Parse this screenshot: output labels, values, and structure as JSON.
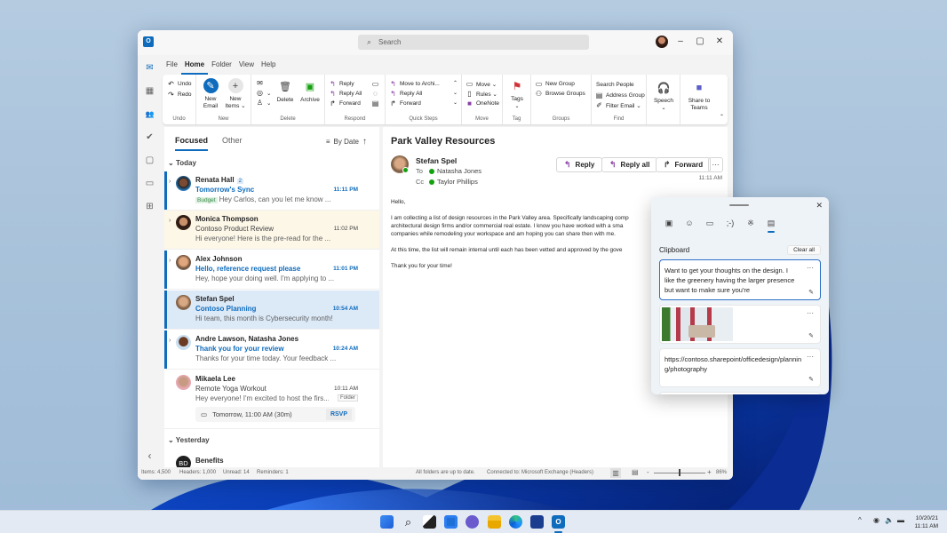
{
  "window": {
    "app_name": "Outlook",
    "search_placeholder": "Search",
    "controls": {
      "minimize": "–",
      "maximize": "▢",
      "close": "✕"
    }
  },
  "left_rail": {
    "items": [
      {
        "name": "mail",
        "icon": "✉"
      },
      {
        "name": "calendar",
        "icon": "▦"
      },
      {
        "name": "people",
        "icon": "👥"
      },
      {
        "name": "tasks",
        "icon": "✔"
      },
      {
        "name": "notes",
        "icon": "▢"
      },
      {
        "name": "folders",
        "icon": "▭"
      },
      {
        "name": "apps",
        "icon": "⊞"
      }
    ],
    "collapse": "‹"
  },
  "menu": {
    "items": [
      "File",
      "Home",
      "Folder",
      "View",
      "Help"
    ],
    "active": "Home"
  },
  "ribbon": {
    "undo": {
      "undo": "Undo",
      "redo": "Redo",
      "label": "Undo"
    },
    "new": {
      "new_email": [
        "New",
        "Email"
      ],
      "new_items": [
        "New",
        "Items ⌄"
      ],
      "label": "New"
    },
    "delete": {
      "delete": "Delete",
      "archive": "Archive",
      "label": "Delete"
    },
    "respond": {
      "reply": "Reply",
      "reply_all": "Reply All",
      "forward": "Forward",
      "label": "Respond"
    },
    "quick_steps": {
      "move_to": "Move to Archi...",
      "reply_all": "Reply All",
      "forward": "Forward",
      "label": "Quick Steps"
    },
    "move": {
      "move": "Move ⌄",
      "rules": "Rules ⌄",
      "onenote": "OneNote",
      "label": "Move"
    },
    "tag": {
      "tags": "Tags",
      "label": "Tag"
    },
    "groups": {
      "new_group": "New Group",
      "browse_groups": "Browse Groups",
      "label": "Groups"
    },
    "find": {
      "search_people": "Search People",
      "address_group": "Address Group",
      "filter_email": "Filter Email ⌄",
      "label": "Find"
    },
    "speech": {
      "label": "Speech"
    },
    "teams": {
      "label": [
        "Share to",
        "Teams"
      ]
    }
  },
  "list": {
    "tabs": [
      "Focused",
      "Other"
    ],
    "sort": "By Date",
    "sections": {
      "today": "Today",
      "yesterday": "Yesterday"
    },
    "items": [
      {
        "name": "Renata Hall",
        "count": "2",
        "subject": "Tomorrow's Sync",
        "time": "11:11 PM",
        "badge": "Budget",
        "preview": "Hey Carlos, can you let me know ...",
        "unread": true
      },
      {
        "name": "Monica Thompson",
        "subject": "Contoso Product Review",
        "time": "11:02 PM",
        "preview": "Hi everyone! Here is the pre-read for the ...",
        "unread": false
      },
      {
        "name": "Alex Johnson",
        "subject": "Hello, reference request please",
        "time": "11:01 PM",
        "preview": "Hey, hope your doing well. I'm applying to ...",
        "unread": true
      },
      {
        "name": "Stefan Spel",
        "subject": "Contoso Planning",
        "time": "10:54 AM",
        "preview": "Hi team, this month is Cybersecurity month!",
        "unread": true
      },
      {
        "name": "Andre Lawson, Natasha Jones",
        "subject": "Thank you for your review",
        "time": "10:24 AM",
        "preview": "Thanks for your time today. Your feedback ...",
        "unread": true
      },
      {
        "name": "Mikaela Lee",
        "subject": "Remote Yoga Workout",
        "time": "10:11 AM",
        "preview": "Hey everyone! I'm excited to host the firs...",
        "folder": "Folder",
        "event": "Tomorrow, 11:00 AM (30m)",
        "rsvp": "RSVP",
        "unread": false
      },
      {
        "name": "Benefits",
        "initials": "BD",
        "subject": "",
        "time": "",
        "preview": ""
      }
    ]
  },
  "reading": {
    "subject": "Park Valley Resources",
    "sender": "Stefan Spel",
    "to_label": "To",
    "to": "Natasha Jones",
    "cc_label": "Cc",
    "cc": "Taylor Phillips",
    "time": "11:11 AM",
    "actions": {
      "reply": "Reply",
      "reply_all": "Reply all",
      "forward": "Forward",
      "more": "···"
    },
    "body": [
      "Hello,",
      "I am collecting a list of design resources in the Park Valley area. Specifically landscaping comp",
      "architectural design firms and/or commercial real estate. I know you have worked with a sma",
      "companies while remodeling your workspace and am hoping you can share then with me.",
      "At this time, the list will remain internal until each has been vetted and approved by the gove",
      "Thank you for your time!"
    ]
  },
  "status": {
    "items": "Items: 4,500",
    "headers": "Headers: 1,000",
    "unread": "Unread: 14",
    "reminders": "Reminders: 1",
    "sync": "All folders are up to date.",
    "connected": "Connected to: Microsoft Exchange (Headers)",
    "zoom": "86%",
    "zoom_value": 0.5
  },
  "clipboard": {
    "title": "Clipboard",
    "clear_all": "Clear all",
    "close": "✕",
    "tabs": [
      "sticker",
      "emoji",
      "gif",
      "kaomoji",
      "symbols",
      "clipboard"
    ],
    "items": [
      {
        "type": "text",
        "text": "Want to get your thoughts on the design. I like the greenery having the larger presence but want to make sure you're"
      },
      {
        "type": "image"
      },
      {
        "type": "text",
        "text": "https://contoso.sharepoint/officedesign/planning/photography"
      }
    ],
    "more": "···",
    "pin": "📌"
  },
  "taskbar": {
    "apps": [
      "start",
      "search",
      "task-view",
      "widgets",
      "teams-chat",
      "file-explorer",
      "edge",
      "store",
      "outlook"
    ],
    "date": "10/20/21",
    "time": "11:11 AM",
    "tray_chevron": "^"
  },
  "colors": {
    "accent": "#0f6cbd",
    "purple": "#8a3ea4",
    "selected_row": "#dce9f7",
    "highlight_row": "#fdf7e8",
    "presence": "#13a10e"
  }
}
